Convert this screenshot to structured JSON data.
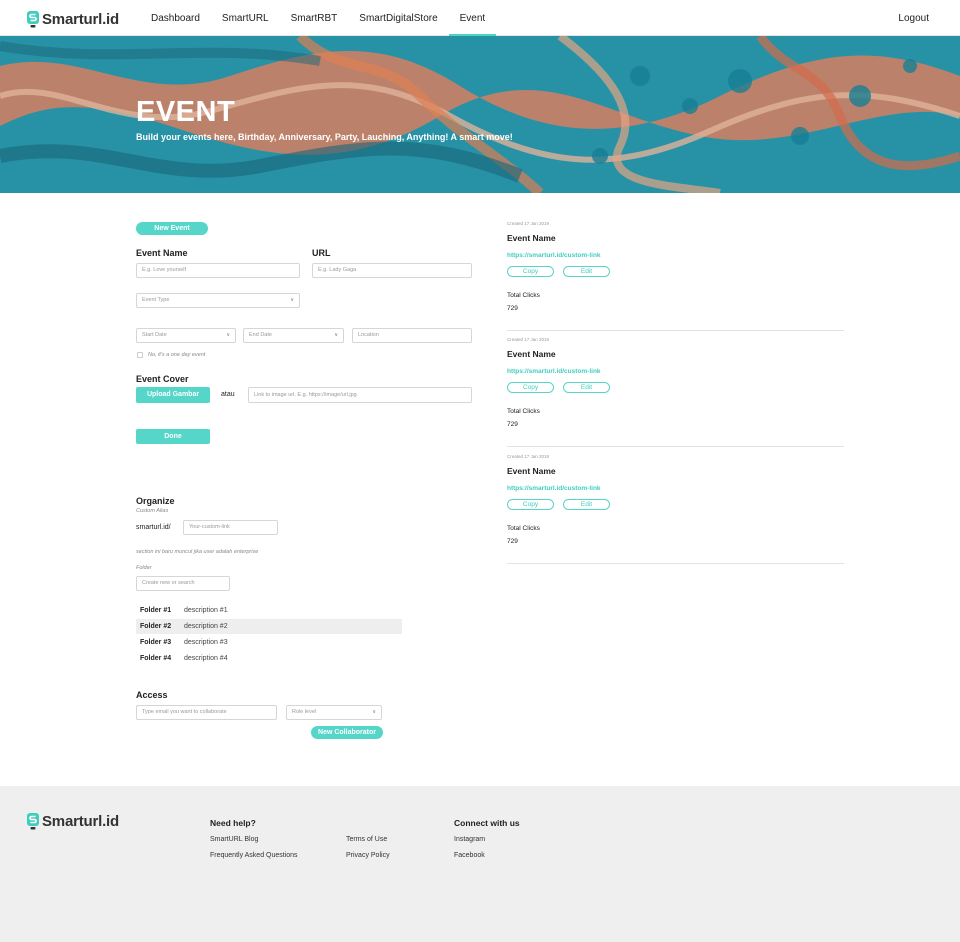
{
  "header": {
    "logo": "Smarturl.id",
    "nav": [
      "Dashboard",
      "SmartURL",
      "SmartRBT",
      "SmartDigitalStore",
      "Event"
    ],
    "active_nav": "Event",
    "logout": "Logout"
  },
  "hero": {
    "title": "EVENT",
    "subtitle": "Build your events here, Birthday, Anniversary, Party, Lauching, Anything! A smart move!"
  },
  "form": {
    "new_event_button": "New Event",
    "event_name_label": "Event Name",
    "event_name_placeholder": "E.g. Love yourself",
    "url_label": "URL",
    "url_placeholder": "E.g. Lady Gaga",
    "event_type_placeholder": "Event Type",
    "start_date_placeholder": "Start Date",
    "end_date_placeholder": "End Date",
    "location_placeholder": "Location",
    "one_day_label": "No, it's a one day event",
    "event_cover_label": "Event Cover",
    "upload_button": "Upload Gambar",
    "or_label": "atau",
    "image_url_placeholder": "Link to image url. E.g. https://image/url.jpg",
    "done_button": "Done"
  },
  "organize": {
    "title": "Organize",
    "custom_alias_label": "Custom Alias",
    "domain_prefix": "smarturl.id/",
    "alias_placeholder": "Your-custom-link",
    "enterprise_note": "section ini baru muncul jika user adalah enterprise",
    "folder_label": "Folder",
    "folder_placeholder": "Create new or search",
    "folders": [
      {
        "name": "Folder #1",
        "description": "description #1"
      },
      {
        "name": "Folder #2",
        "description": "description #2"
      },
      {
        "name": "Folder #3",
        "description": "description #3"
      },
      {
        "name": "Folder #4",
        "description": "description #4"
      }
    ]
  },
  "access": {
    "title": "Access",
    "email_placeholder": "Type email you want to collaborate",
    "role_placeholder": "Role level",
    "new_collaborator_button": "New Collaborator"
  },
  "events": [
    {
      "created": "Created 17 Jan 2019",
      "name": "Event Name",
      "link": "https://smarturl.id/custom-link",
      "copy": "Copy",
      "edit": "Edit",
      "clicks_label": "Total Clicks",
      "clicks": "729"
    },
    {
      "created": "Created 17 Jan 2019",
      "name": "Event Name",
      "link": "https://smarturl.id/custom-link",
      "copy": "Copy",
      "edit": "Edit",
      "clicks_label": "Total Clicks",
      "clicks": "729"
    },
    {
      "created": "Created 17 Jan 2019",
      "name": "Event Name",
      "link": "https://smarturl.id/custom-link",
      "copy": "Copy",
      "edit": "Edit",
      "clicks_label": "Total Clicks",
      "clicks": "729"
    }
  ],
  "footer": {
    "logo": "Smarturl.id",
    "help_title": "Need help?",
    "help_links": [
      "SmartURL Blog",
      "Frequently Asked Questions"
    ],
    "legal_links": [
      "Terms of Use",
      "Privacy Policy"
    ],
    "connect_title": "Connect with us",
    "social_links": [
      "Instagram",
      "Facebook"
    ]
  },
  "colors": {
    "accent": "#55d6c8",
    "link": "#3fcdbd",
    "footer_bg": "#efefef"
  }
}
